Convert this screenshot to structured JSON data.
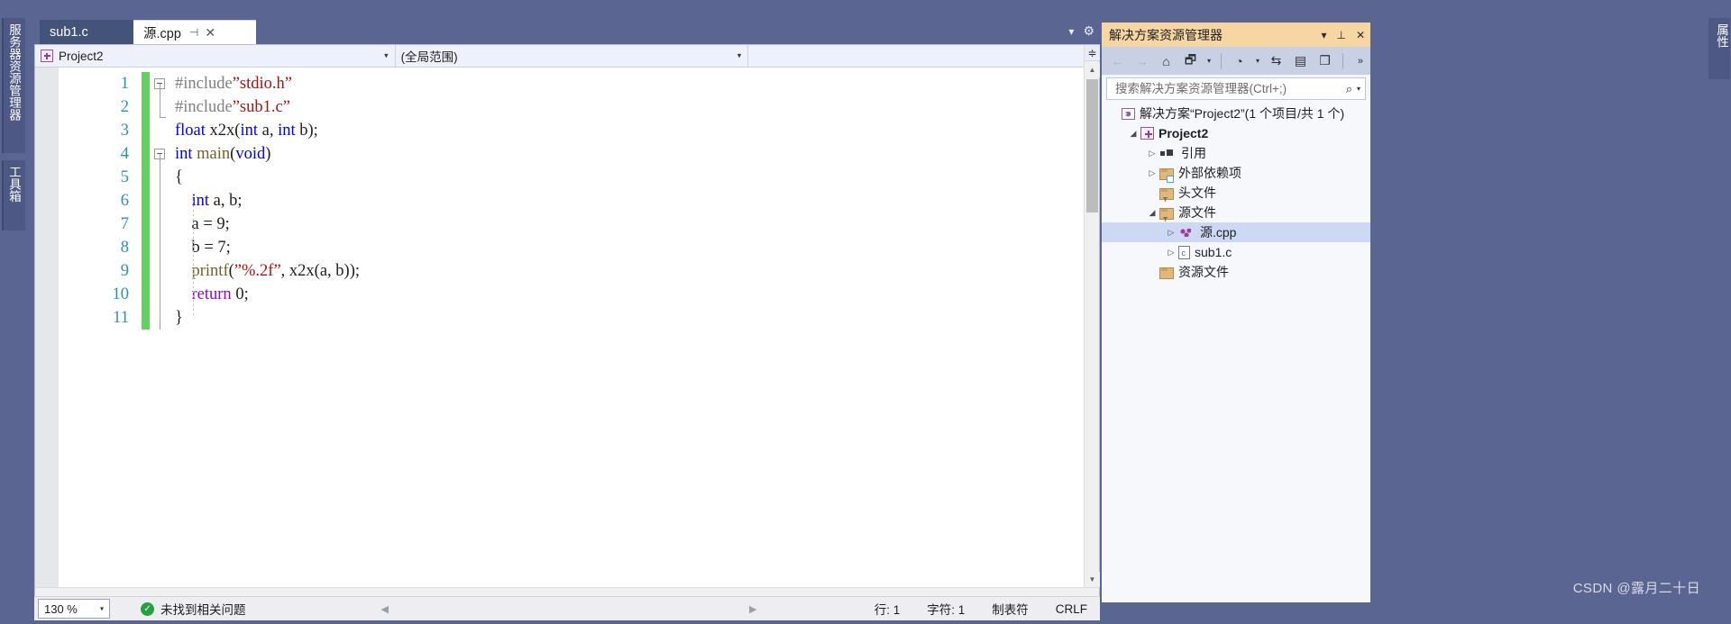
{
  "left_dock": {
    "tabs": [
      {
        "label": "服务器资源管理器"
      },
      {
        "label": "工具箱"
      }
    ]
  },
  "right_dock": {
    "tabs": [
      {
        "label": "属性"
      }
    ]
  },
  "editor": {
    "tabs": [
      {
        "label": "sub1.c",
        "active": false
      },
      {
        "label": "源.cpp",
        "active": true,
        "pin": "⊣",
        "close": "✕"
      }
    ],
    "tabstrip_icons": {
      "dropdown": "▾",
      "gear": "⚙"
    },
    "navbar": {
      "project_combo": "Project2",
      "scope_combo": "(全局范围)",
      "member_combo": "",
      "arrow": "▾"
    },
    "line_numbers": [
      "1",
      "2",
      "3",
      "4",
      "5",
      "6",
      "7",
      "8",
      "9",
      "10",
      "11"
    ],
    "code_lines": [
      {
        "n": 1,
        "outline": true,
        "tokens": [
          {
            "t": "#include",
            "c": "pp"
          },
          {
            "t": "”stdio.h”",
            "c": "str"
          }
        ]
      },
      {
        "n": 2,
        "outline": false,
        "tokens": [
          {
            "t": "#include",
            "c": "pp"
          },
          {
            "t": "”sub1.c”",
            "c": "str"
          }
        ]
      },
      {
        "n": 3,
        "outline": false,
        "tokens": [
          {
            "t": "float ",
            "c": "kw"
          },
          {
            "t": "x2x",
            "c": "plain"
          },
          {
            "t": "(",
            "c": "plain"
          },
          {
            "t": "int",
            "c": "kw"
          },
          {
            "t": " a, ",
            "c": "plain"
          },
          {
            "t": "int",
            "c": "kw"
          },
          {
            "t": " b);",
            "c": "plain"
          }
        ]
      },
      {
        "n": 4,
        "outline": true,
        "tokens": [
          {
            "t": "int",
            "c": "kw"
          },
          {
            "t": " ",
            "c": "plain"
          },
          {
            "t": "main",
            "c": "fn"
          },
          {
            "t": "(",
            "c": "plain"
          },
          {
            "t": "void",
            "c": "kw"
          },
          {
            "t": ")",
            "c": "plain"
          }
        ]
      },
      {
        "n": 5,
        "outline": false,
        "tokens": [
          {
            "t": "{",
            "c": "plain"
          }
        ]
      },
      {
        "n": 6,
        "outline": false,
        "tokens": [
          {
            "t": "    ",
            "c": "plain"
          },
          {
            "t": "int",
            "c": "kw"
          },
          {
            "t": " a, b;",
            "c": "plain"
          }
        ]
      },
      {
        "n": 7,
        "outline": false,
        "tokens": [
          {
            "t": "    a = 9;",
            "c": "plain"
          }
        ]
      },
      {
        "n": 8,
        "outline": false,
        "tokens": [
          {
            "t": "    b = 7;",
            "c": "plain"
          }
        ]
      },
      {
        "n": 9,
        "outline": false,
        "tokens": [
          {
            "t": "    ",
            "c": "plain"
          },
          {
            "t": "printf",
            "c": "fn"
          },
          {
            "t": "(",
            "c": "plain"
          },
          {
            "t": "”%.2f”",
            "c": "str"
          },
          {
            "t": ", x2x(a, b));",
            "c": "plain"
          }
        ]
      },
      {
        "n": 10,
        "outline": false,
        "tokens": [
          {
            "t": "    ",
            "c": "plain"
          },
          {
            "t": "return",
            "c": "ctl"
          },
          {
            "t": " 0;",
            "c": "plain"
          }
        ]
      },
      {
        "n": 11,
        "outline": false,
        "tokens": [
          {
            "t": "}",
            "c": "plain"
          }
        ]
      }
    ],
    "scrollbar": {
      "split": "≑",
      "up": "▲",
      "down": "▼"
    }
  },
  "statusbar": {
    "zoom": "130 %",
    "zoom_arrow": "▾",
    "problems_icon": "✓",
    "problems": "未找到相关问题",
    "nav_left": "◀",
    "nav_right": "▶",
    "line": "行: 1",
    "column": "字符: 1",
    "indent": "制表符",
    "eol": "CRLF"
  },
  "solution_explorer": {
    "title": "解决方案资源管理器",
    "title_icons": {
      "dropdown": "▾",
      "pin": "📌",
      "close": "✕"
    },
    "toolbar": {
      "back": "←",
      "forward": "→",
      "home": "⌂",
      "sync": "🗗",
      "sync_caret": "▾",
      "pending": "◔",
      "pending_caret": "▾",
      "toggle": "⇆",
      "properties": "▤",
      "show_all": "❐",
      "overflow": "»"
    },
    "search_placeholder": "搜索解决方案资源管理器(Ctrl+;)",
    "search_value": "",
    "search_icon": "⌕",
    "search_caret": "▾",
    "tree": [
      {
        "label": "解决方案“Project2”(1 个项目/共 1 个)",
        "indent": 0,
        "twist": "",
        "icon": "ic-sln",
        "bold": false,
        "selected": false
      },
      {
        "label": "Project2",
        "indent": 1,
        "twist": "◢",
        "icon": "ic-proj",
        "bold": true,
        "selected": false
      },
      {
        "label": "引用",
        "indent": 2,
        "twist": "▷",
        "icon": "ic-ref",
        "bold": false,
        "selected": false
      },
      {
        "label": "外部依赖项",
        "indent": 2,
        "twist": "▷",
        "icon": "ic-folder ext",
        "bold": false,
        "selected": false
      },
      {
        "label": "头文件",
        "indent": 2,
        "twist": "",
        "icon": "ic-folder filt",
        "bold": false,
        "selected": false
      },
      {
        "label": "源文件",
        "indent": 2,
        "twist": "◢",
        "icon": "ic-folder filt",
        "bold": false,
        "selected": false
      },
      {
        "label": "源.cpp",
        "indent": 3,
        "twist": "▷",
        "icon": "ic-cpp",
        "bold": false,
        "selected": true
      },
      {
        "label": "sub1.c",
        "indent": 3,
        "twist": "▷",
        "icon": "ic-cfile",
        "bold": false,
        "selected": false
      },
      {
        "label": "资源文件",
        "indent": 2,
        "twist": "",
        "icon": "ic-folder",
        "bold": false,
        "selected": false
      }
    ]
  },
  "watermark": "CSDN @露月二十日"
}
